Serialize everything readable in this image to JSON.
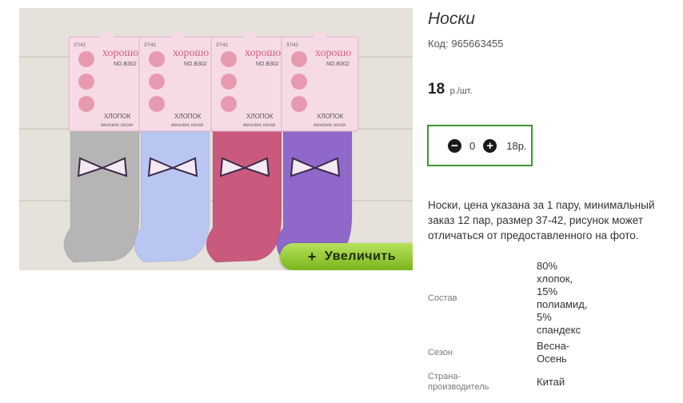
{
  "product": {
    "title": "Носки",
    "code_label": "Код:",
    "code_value": "965663455",
    "price_amount": "18",
    "price_unit": "р./шт."
  },
  "image": {
    "brand_text": "хорошо",
    "size_text": "37/42",
    "model_text": "NO.B302",
    "material_text": "ХЛОПОК",
    "sub_text": "женские носки",
    "sock_colors": [
      "#b5b5b5",
      "#b9c6f2",
      "#c95a7e",
      "#8f68c9"
    ],
    "zoom_button_plus": "+",
    "zoom_button_label": "Увеличить"
  },
  "quantity": {
    "minus_symbol": "−",
    "value": "0",
    "plus_symbol": "+",
    "total": "18р."
  },
  "description": "Носки, цена указана за 1 пару, минимальный заказ 12 пар, размер 37-42, рисунок может отличаться от предоставленного на фото.",
  "properties": [
    {
      "name": "Состав",
      "value_lines": [
        "80%",
        "хлопок,",
        "15%",
        "полиамид,",
        "5%",
        "спандекс"
      ]
    },
    {
      "name": "Сезон",
      "value_lines": [
        "Весна-",
        "Осень"
      ]
    },
    {
      "name_lines": [
        "Страна-",
        "производитель"
      ],
      "value_lines": [
        "Китай"
      ]
    }
  ],
  "accent_color": "#3a9a2e"
}
